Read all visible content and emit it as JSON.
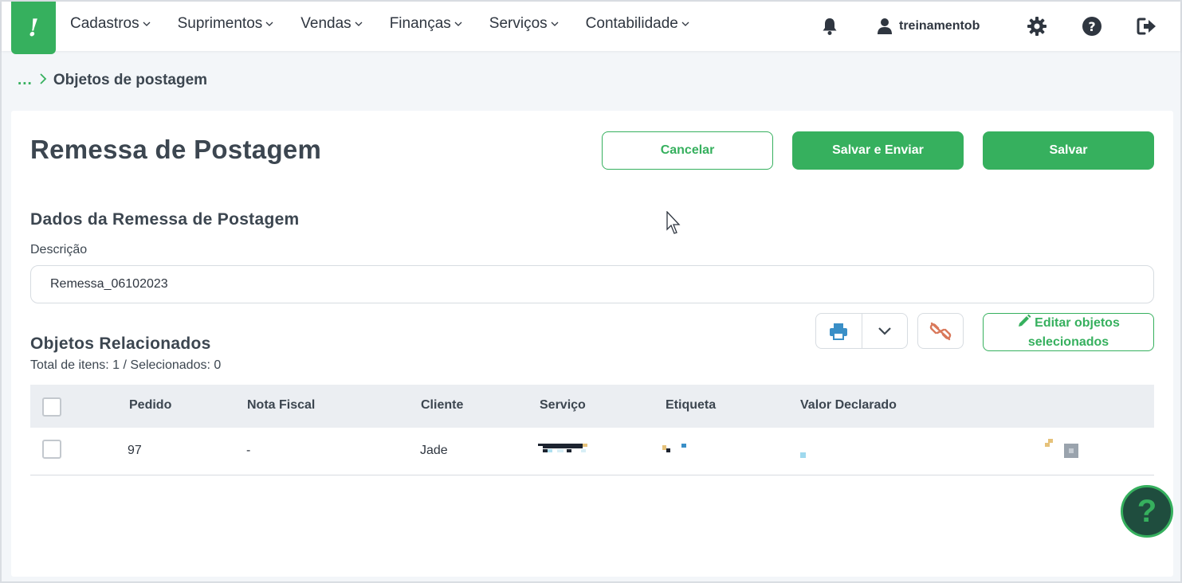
{
  "brand": {
    "logo_glyph": "!",
    "color": "#36b05e"
  },
  "nav": {
    "items": [
      {
        "label": "Cadastros"
      },
      {
        "label": "Suprimentos"
      },
      {
        "label": "Vendas"
      },
      {
        "label": "Finanças"
      },
      {
        "label": "Serviços"
      },
      {
        "label": "Contabilidade"
      }
    ],
    "username": "treinamentob",
    "icons": [
      "bell-icon",
      "user-icon",
      "gear-icon",
      "help-icon",
      "logout-icon"
    ]
  },
  "breadcrumb": {
    "ellipsis": "...",
    "current": "Objetos de postagem"
  },
  "page": {
    "title": "Remessa de Postagem",
    "buttons": {
      "cancel": "Cancelar",
      "save_send": "Salvar e Enviar",
      "save": "Salvar"
    }
  },
  "form": {
    "section_title": "Dados da Remessa de Postagem",
    "description_label": "Descrição",
    "description_value": "Remessa_06102023"
  },
  "related": {
    "section_title": "Objetos Relacionados",
    "totals": "Total de itens: 1 / Selecionados: 0",
    "edit_button": "Editar objetos selecionados",
    "icons": [
      "printer-icon",
      "chevron-down-icon",
      "unlink-icon",
      "pencil-icon"
    ]
  },
  "table": {
    "headers": [
      "Pedido",
      "Nota Fiscal",
      "Cliente",
      "Serviço",
      "Etiqueta",
      "Valor Declarado"
    ],
    "rows": [
      {
        "pedido": "97",
        "nota_fiscal": "-",
        "cliente": "Jade"
      }
    ]
  },
  "help_fab": {
    "glyph": "?"
  }
}
